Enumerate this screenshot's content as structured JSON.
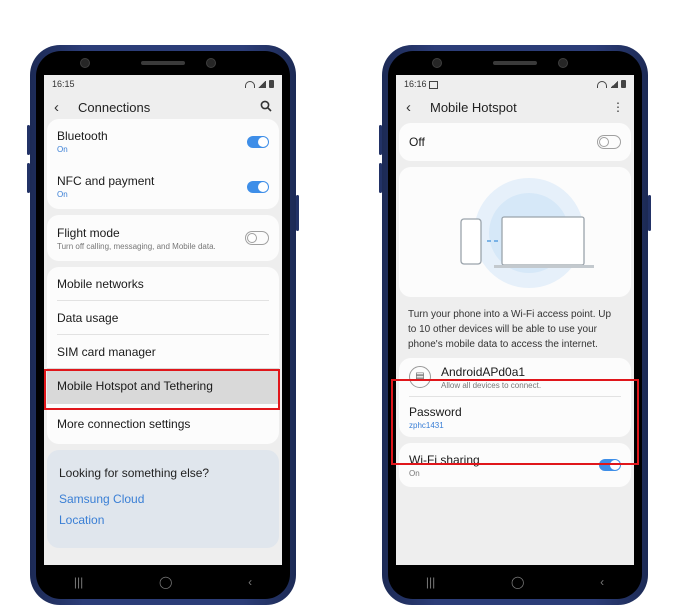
{
  "left": {
    "status_time": "16:15",
    "title": "Connections",
    "items": {
      "bluetooth": {
        "label": "Bluetooth",
        "sub": "On"
      },
      "nfc": {
        "label": "NFC and payment",
        "sub": "On"
      },
      "flight": {
        "label": "Flight mode",
        "sub": "Turn off calling, messaging, and Mobile data."
      },
      "mobile_networks": "Mobile networks",
      "data_usage": "Data usage",
      "sim": "SIM card manager",
      "hotspot": "Mobile Hotspot and Tethering",
      "more": "More connection settings"
    },
    "looking": {
      "heading": "Looking for something else?",
      "links": [
        "Samsung Cloud",
        "Location"
      ]
    }
  },
  "right": {
    "status_time": "16:16",
    "title": "Mobile Hotspot",
    "off_label": "Off",
    "description": "Turn your phone into a Wi-Fi access point. Up to 10 other devices will be able to use your phone's mobile data to access the internet.",
    "network_name": "AndroidAPd0a1",
    "network_sub": "Allow all devices to connect.",
    "password_label": "Password",
    "password_value": "zphc1431",
    "wifi_sharing_label": "Wi-Fi sharing",
    "wifi_sharing_sub": "On"
  },
  "nav": {
    "recents": "|||",
    "home": "◯",
    "back": "‹"
  },
  "colors": {
    "accent": "#3e8ee8",
    "highlight": "#e0161b",
    "frame": "#2c3d78"
  }
}
